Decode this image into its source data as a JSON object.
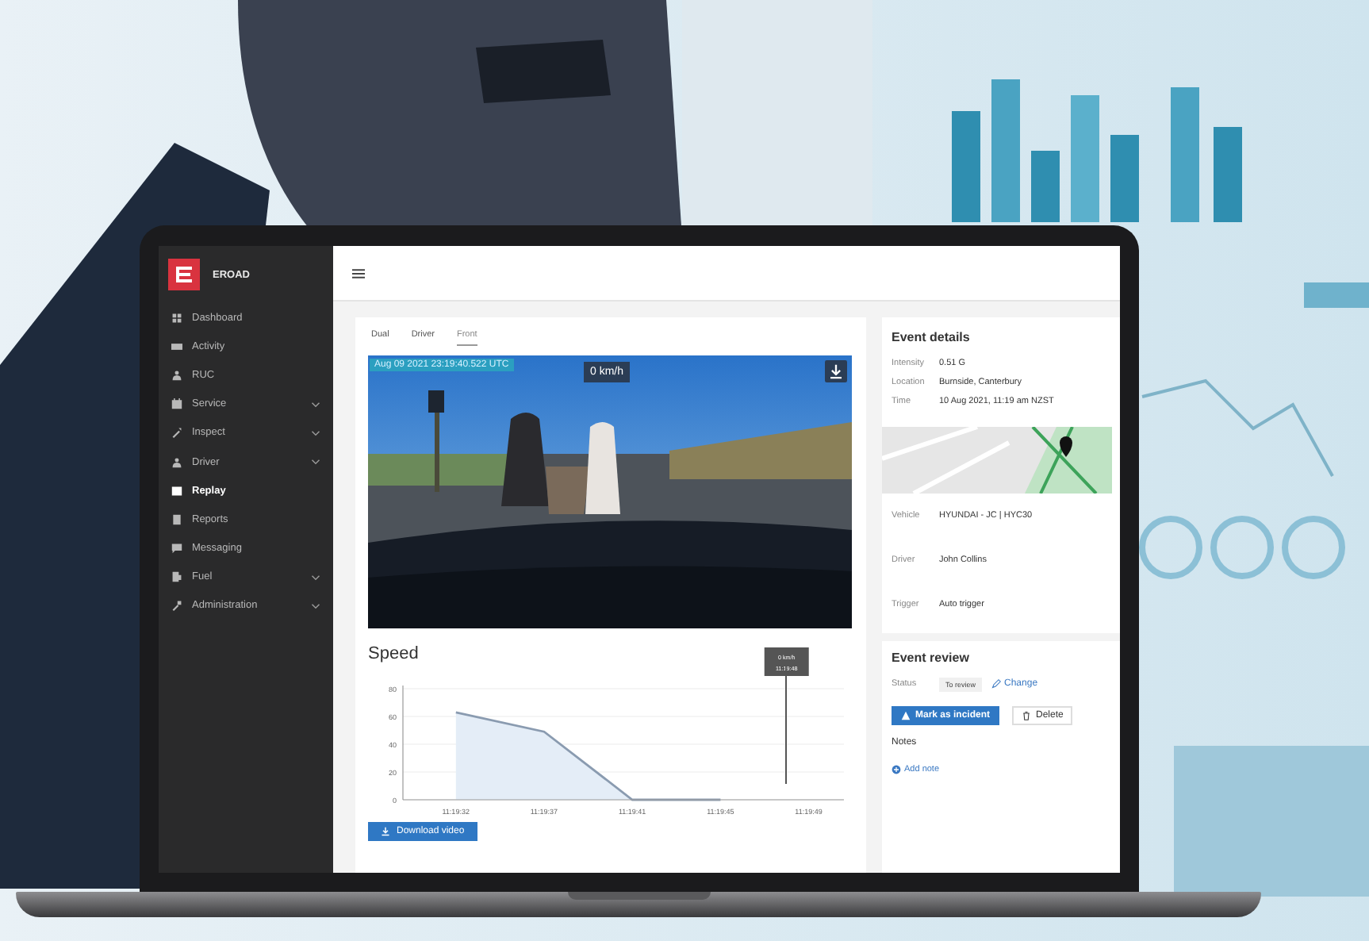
{
  "app": {
    "logo": "EROAD"
  },
  "sidebar": {
    "items": [
      {
        "label": "Dashboard",
        "expandable": false,
        "selected": false
      },
      {
        "label": "Activity",
        "expandable": false,
        "selected": false
      },
      {
        "label": "RUC",
        "expandable": false,
        "selected": false
      },
      {
        "label": "Service",
        "expandable": true,
        "selected": false
      },
      {
        "label": "Inspect",
        "expandable": true,
        "selected": false
      },
      {
        "label": "Driver",
        "expandable": true,
        "selected": false
      },
      {
        "label": "Replay",
        "expandable": false,
        "selected": true
      },
      {
        "label": "Reports",
        "expandable": false,
        "selected": false
      },
      {
        "label": "Messaging",
        "expandable": false,
        "selected": false
      },
      {
        "label": "Fuel",
        "expandable": true,
        "selected": false
      },
      {
        "label": "Administration",
        "expandable": true,
        "selected": false
      }
    ]
  },
  "player": {
    "tabs": [
      {
        "label": "Dual",
        "selected": false
      },
      {
        "label": "Driver",
        "selected": false
      },
      {
        "label": "Front",
        "selected": true
      }
    ],
    "timestamp": "Aug 09 2021 23:19:40.522 UTC",
    "speed": "0 km/h"
  },
  "speed_panel": {
    "title": "Speed",
    "cursor": {
      "speed": "0 km/h",
      "time": "11:19:48"
    },
    "chart_data": {
      "type": "area",
      "grid": true,
      "categories": [
        "11:19:32",
        "11:19:37",
        "11:19:41",
        "11:19:45",
        "11:19:49"
      ],
      "series": [
        {
          "color": "#8a9bb0",
          "values": [
            63,
            49,
            0,
            0,
            null
          ]
        }
      ],
      "ylim": [
        0,
        80
      ],
      "yticks": [
        0,
        20,
        40,
        60,
        80
      ]
    },
    "download_button": "Download video"
  },
  "event_details": {
    "title": "Event details",
    "fields": [
      {
        "label": "Intensity",
        "value": "0.51 G"
      },
      {
        "label": "Location",
        "value": "Burnside, Canterbury"
      },
      {
        "label": "Time",
        "value": "10 Aug 2021, 11:19 am NZST"
      }
    ],
    "more_fields": [
      {
        "label": "Vehicle",
        "value": "HYUNDAI - JC | HYC30"
      },
      {
        "label": "Driver",
        "value": "John Collins"
      },
      {
        "label": "Trigger",
        "value": "Auto trigger"
      }
    ]
  },
  "event_review": {
    "title": "Event review",
    "status_label": "Status",
    "status": "To review",
    "change_link": "Change",
    "incident_button": "Mark as incident",
    "delete_button": "Delete",
    "notes_title": "Notes",
    "add_note": "Add note"
  }
}
